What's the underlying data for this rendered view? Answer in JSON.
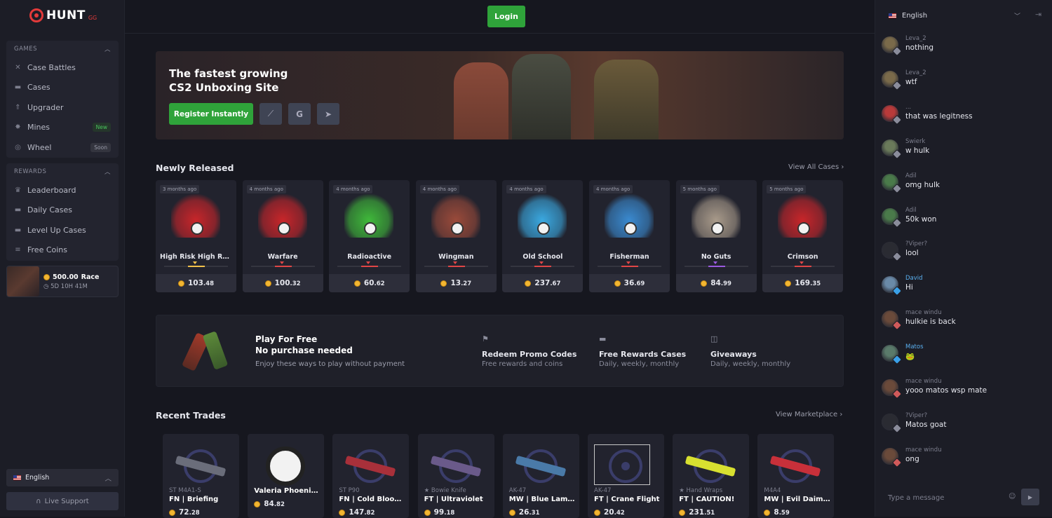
{
  "logo": {
    "text": "HUNT",
    "suffix": "GG"
  },
  "header": {
    "login_label": "Login"
  },
  "sidebar": {
    "games_header": "GAMES",
    "games": [
      {
        "label": "Case Battles",
        "icon": "swords-icon",
        "badge": ""
      },
      {
        "label": "Cases",
        "icon": "case-icon",
        "badge": ""
      },
      {
        "label": "Upgrader",
        "icon": "upgrade-icon",
        "badge": ""
      },
      {
        "label": "Mines",
        "icon": "mine-icon",
        "badge": "New"
      },
      {
        "label": "Wheel",
        "icon": "wheel-icon",
        "badge": "Soon"
      }
    ],
    "rewards_header": "REWARDS",
    "rewards": [
      {
        "label": "Leaderboard",
        "icon": "trophy-icon"
      },
      {
        "label": "Daily Cases",
        "icon": "case-icon"
      },
      {
        "label": "Level Up Cases",
        "icon": "case-icon"
      },
      {
        "label": "Free Coins",
        "icon": "coins-icon"
      }
    ],
    "race": {
      "amount": "500.00",
      "label": "Race",
      "timer": "5D 10H 41M"
    },
    "language": "English",
    "support_label": "Live Support"
  },
  "hero": {
    "title": "The fastest growing CS2 Unboxing Site",
    "register_label": "Register Instantly",
    "socials": [
      "steam-icon",
      "google-icon",
      "telegram-icon"
    ]
  },
  "newly_released": {
    "title": "Newly Released",
    "link": "View All Cases",
    "cases": [
      {
        "age": "3 months ago",
        "name": "High Risk High Rew...",
        "price_int": "103",
        "price_dec": ".48",
        "rarity": "#f2c14a",
        "tint": "#c8252a"
      },
      {
        "age": "4 months ago",
        "name": "Warfare",
        "price_int": "100",
        "price_dec": ".32",
        "rarity": "#e04646",
        "tint": "#c8252a"
      },
      {
        "age": "4 months ago",
        "name": "Radioactive",
        "price_int": "60",
        "price_dec": ".62",
        "rarity": "#e04646",
        "tint": "#3fb93a"
      },
      {
        "age": "4 months ago",
        "name": "Wingman",
        "price_int": "13",
        "price_dec": ".27",
        "rarity": "#e04646",
        "tint": "#9a4a3a"
      },
      {
        "age": "4 months ago",
        "name": "Old School",
        "price_int": "237",
        "price_dec": ".67",
        "rarity": "#e04646",
        "tint": "#3aa8e0"
      },
      {
        "age": "4 months ago",
        "name": "Fisherman",
        "price_int": "36",
        "price_dec": ".69",
        "rarity": "#e04646",
        "tint": "#3a8ad0"
      },
      {
        "age": "5 months ago",
        "name": "No Guts",
        "price_int": "84",
        "price_dec": ".99",
        "rarity": "#9a5ae0",
        "tint": "#a89a8a"
      },
      {
        "age": "5 months ago",
        "name": "Crimson",
        "price_int": "169",
        "price_dec": ".35",
        "rarity": "#e04646",
        "tint": "#c8252a"
      }
    ]
  },
  "free_play": {
    "title_line1": "Play For Free",
    "title_line2": "No purchase needed",
    "subtitle": "Enjoy these ways to play without payment",
    "features": [
      {
        "icon": "flag-icon",
        "title": "Redeem Promo Codes",
        "sub": "Free rewards and coins"
      },
      {
        "icon": "case-icon",
        "title": "Free Rewards Cases",
        "sub": "Daily, weekly, monthly"
      },
      {
        "icon": "gift-icon",
        "title": "Giveaways",
        "sub": "Daily, weekly, monthly"
      }
    ]
  },
  "recent_trades": {
    "title": "Recent Trades",
    "link": "View Marketplace",
    "items": [
      {
        "category": "ST M4A1-S",
        "name": "FN | Briefing",
        "price_int": "72",
        "price_dec": ".28",
        "gun": "#6a6d7a"
      },
      {
        "category": "",
        "name": "Valeria Phoenix ...",
        "price_int": "84",
        "price_dec": ".82",
        "gun": ""
      },
      {
        "category": "ST P90",
        "name": "FN | Cold Blooded",
        "price_int": "147",
        "price_dec": ".82",
        "gun": "#a8303a"
      },
      {
        "category": "★ Bowie Knife",
        "name": "FT | Ultraviolet",
        "price_int": "99",
        "price_dec": ".18",
        "gun": "#6a5a8a"
      },
      {
        "category": "AK-47",
        "name": "MW | Blue Lamin...",
        "price_int": "26",
        "price_dec": ".31",
        "gun": "#4a7aa8"
      },
      {
        "category": "AK-47",
        "name": "FT | Crane Flight",
        "price_int": "20",
        "price_dec": ".42",
        "gun": ""
      },
      {
        "category": "★ Hand Wraps",
        "name": "FT | CAUTION!",
        "price_int": "231",
        "price_dec": ".51",
        "gun": "#d8e030"
      },
      {
        "category": "M4A4",
        "name": "MW | Evil Daimyo",
        "price_int": "8",
        "price_dec": ".59",
        "gun": "#c8303a"
      }
    ]
  },
  "chat": {
    "language": "English",
    "placeholder": "Type a message",
    "messages": [
      {
        "user": "Leva_2",
        "text": "nothing",
        "level_color": "#8a8c9b",
        "avatar": "#7a6a4a"
      },
      {
        "user": "Leva_2",
        "text": "wtf",
        "level_color": "#8a8c9b",
        "avatar": "#7a6a4a"
      },
      {
        "user": "...",
        "text": "that was legitness",
        "level_color": "#8a8c9b",
        "avatar": "#b83a3a"
      },
      {
        "user": "Swierk",
        "text": "w hulk",
        "level_color": "#8a8c9b",
        "avatar": "#6a7a5a"
      },
      {
        "user": "Adil",
        "text": "omg hulk",
        "level_color": "#8a8c9b",
        "avatar": "#4a7a4a"
      },
      {
        "user": "Adil",
        "text": "50k won",
        "level_color": "#8a8c9b",
        "avatar": "#4a7a4a"
      },
      {
        "user": "?Viper?",
        "text": "lool",
        "level_color": "#8a8c9b",
        "avatar": "#2a2b32"
      },
      {
        "user": "David",
        "text": "Hi",
        "level_color": "#3aa0e8",
        "avatar": "#6a8aa8",
        "user_color": "#5ab0f0"
      },
      {
        "user": "mace windu",
        "text": "hulkie is back",
        "level_color": "#d05a5a",
        "avatar": "#6a4a3a"
      },
      {
        "user": "Matos",
        "text": "🐸",
        "level_color": "#3aa0e8",
        "avatar": "#5a7a6a",
        "user_color": "#5ab0f0"
      },
      {
        "user": "mace windu",
        "text": "yooo matos wsp mate",
        "level_color": "#d05a5a",
        "avatar": "#6a4a3a"
      },
      {
        "user": "?Viper?",
        "text": "Matos goat",
        "level_color": "#8a8c9b",
        "avatar": "#2a2b32"
      },
      {
        "user": "mace windu",
        "text": "ong",
        "level_color": "#d05a5a",
        "avatar": "#6a4a3a"
      }
    ]
  }
}
